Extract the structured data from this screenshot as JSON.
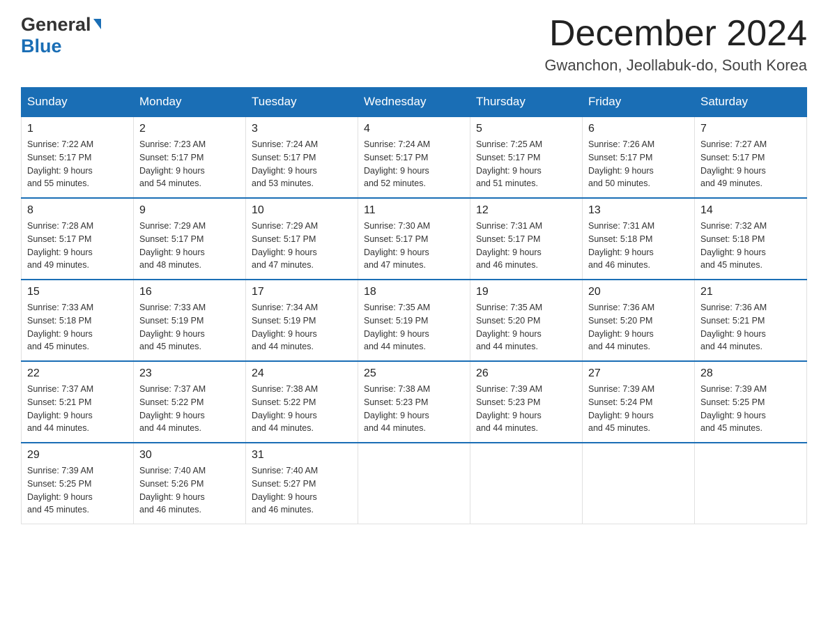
{
  "header": {
    "logo_general": "General",
    "logo_blue": "Blue",
    "title": "December 2024",
    "location": "Gwanchon, Jeollabuk-do, South Korea"
  },
  "days_of_week": [
    "Sunday",
    "Monday",
    "Tuesday",
    "Wednesday",
    "Thursday",
    "Friday",
    "Saturday"
  ],
  "weeks": [
    [
      {
        "day": "1",
        "sunrise": "7:22 AM",
        "sunset": "5:17 PM",
        "daylight": "9 hours and 55 minutes."
      },
      {
        "day": "2",
        "sunrise": "7:23 AM",
        "sunset": "5:17 PM",
        "daylight": "9 hours and 54 minutes."
      },
      {
        "day": "3",
        "sunrise": "7:24 AM",
        "sunset": "5:17 PM",
        "daylight": "9 hours and 53 minutes."
      },
      {
        "day": "4",
        "sunrise": "7:24 AM",
        "sunset": "5:17 PM",
        "daylight": "9 hours and 52 minutes."
      },
      {
        "day": "5",
        "sunrise": "7:25 AM",
        "sunset": "5:17 PM",
        "daylight": "9 hours and 51 minutes."
      },
      {
        "day": "6",
        "sunrise": "7:26 AM",
        "sunset": "5:17 PM",
        "daylight": "9 hours and 50 minutes."
      },
      {
        "day": "7",
        "sunrise": "7:27 AM",
        "sunset": "5:17 PM",
        "daylight": "9 hours and 49 minutes."
      }
    ],
    [
      {
        "day": "8",
        "sunrise": "7:28 AM",
        "sunset": "5:17 PM",
        "daylight": "9 hours and 49 minutes."
      },
      {
        "day": "9",
        "sunrise": "7:29 AM",
        "sunset": "5:17 PM",
        "daylight": "9 hours and 48 minutes."
      },
      {
        "day": "10",
        "sunrise": "7:29 AM",
        "sunset": "5:17 PM",
        "daylight": "9 hours and 47 minutes."
      },
      {
        "day": "11",
        "sunrise": "7:30 AM",
        "sunset": "5:17 PM",
        "daylight": "9 hours and 47 minutes."
      },
      {
        "day": "12",
        "sunrise": "7:31 AM",
        "sunset": "5:17 PM",
        "daylight": "9 hours and 46 minutes."
      },
      {
        "day": "13",
        "sunrise": "7:31 AM",
        "sunset": "5:18 PM",
        "daylight": "9 hours and 46 minutes."
      },
      {
        "day": "14",
        "sunrise": "7:32 AM",
        "sunset": "5:18 PM",
        "daylight": "9 hours and 45 minutes."
      }
    ],
    [
      {
        "day": "15",
        "sunrise": "7:33 AM",
        "sunset": "5:18 PM",
        "daylight": "9 hours and 45 minutes."
      },
      {
        "day": "16",
        "sunrise": "7:33 AM",
        "sunset": "5:19 PM",
        "daylight": "9 hours and 45 minutes."
      },
      {
        "day": "17",
        "sunrise": "7:34 AM",
        "sunset": "5:19 PM",
        "daylight": "9 hours and 44 minutes."
      },
      {
        "day": "18",
        "sunrise": "7:35 AM",
        "sunset": "5:19 PM",
        "daylight": "9 hours and 44 minutes."
      },
      {
        "day": "19",
        "sunrise": "7:35 AM",
        "sunset": "5:20 PM",
        "daylight": "9 hours and 44 minutes."
      },
      {
        "day": "20",
        "sunrise": "7:36 AM",
        "sunset": "5:20 PM",
        "daylight": "9 hours and 44 minutes."
      },
      {
        "day": "21",
        "sunrise": "7:36 AM",
        "sunset": "5:21 PM",
        "daylight": "9 hours and 44 minutes."
      }
    ],
    [
      {
        "day": "22",
        "sunrise": "7:37 AM",
        "sunset": "5:21 PM",
        "daylight": "9 hours and 44 minutes."
      },
      {
        "day": "23",
        "sunrise": "7:37 AM",
        "sunset": "5:22 PM",
        "daylight": "9 hours and 44 minutes."
      },
      {
        "day": "24",
        "sunrise": "7:38 AM",
        "sunset": "5:22 PM",
        "daylight": "9 hours and 44 minutes."
      },
      {
        "day": "25",
        "sunrise": "7:38 AM",
        "sunset": "5:23 PM",
        "daylight": "9 hours and 44 minutes."
      },
      {
        "day": "26",
        "sunrise": "7:39 AM",
        "sunset": "5:23 PM",
        "daylight": "9 hours and 44 minutes."
      },
      {
        "day": "27",
        "sunrise": "7:39 AM",
        "sunset": "5:24 PM",
        "daylight": "9 hours and 45 minutes."
      },
      {
        "day": "28",
        "sunrise": "7:39 AM",
        "sunset": "5:25 PM",
        "daylight": "9 hours and 45 minutes."
      }
    ],
    [
      {
        "day": "29",
        "sunrise": "7:39 AM",
        "sunset": "5:25 PM",
        "daylight": "9 hours and 45 minutes."
      },
      {
        "day": "30",
        "sunrise": "7:40 AM",
        "sunset": "5:26 PM",
        "daylight": "9 hours and 46 minutes."
      },
      {
        "day": "31",
        "sunrise": "7:40 AM",
        "sunset": "5:27 PM",
        "daylight": "9 hours and 46 minutes."
      },
      null,
      null,
      null,
      null
    ]
  ],
  "labels": {
    "sunrise": "Sunrise:",
    "sunset": "Sunset:",
    "daylight": "Daylight:"
  }
}
